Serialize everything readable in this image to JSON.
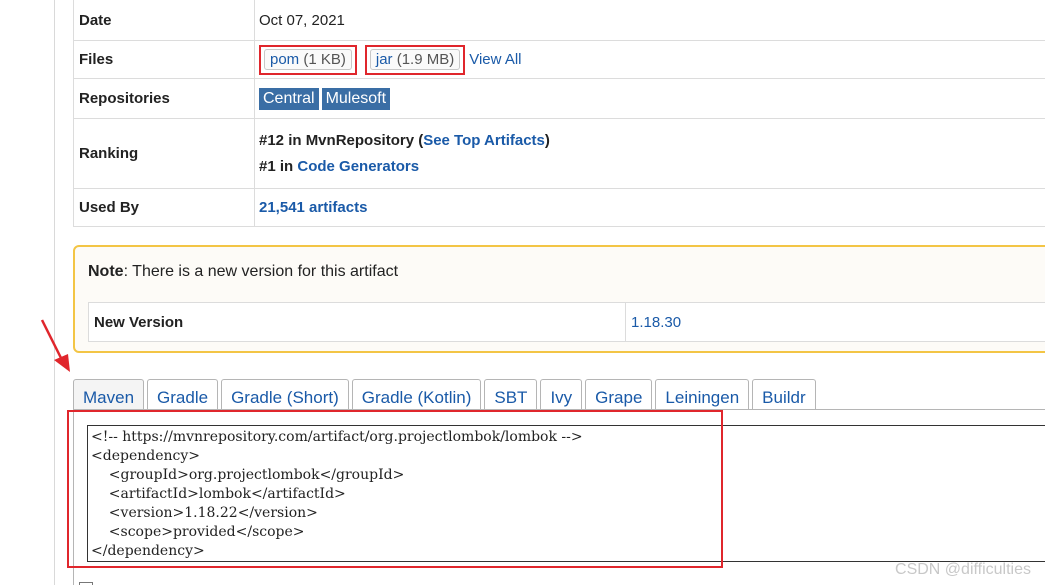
{
  "details": {
    "date": {
      "label": "Date",
      "value": "Oct 07, 2021"
    },
    "files": {
      "label": "Files",
      "pom": {
        "name": "pom",
        "size": "(1 KB)"
      },
      "jar": {
        "name": "jar",
        "size": "(1.9 MB)"
      },
      "view_all": "View All"
    },
    "repositories": {
      "label": "Repositories",
      "items": [
        "Central",
        "Mulesoft"
      ]
    },
    "ranking": {
      "label": "Ranking",
      "line1": {
        "prefix": "#12 in MvnRepository (",
        "link": "See Top Artifacts",
        "suffix": ")"
      },
      "line2": {
        "prefix": "#1 in ",
        "link": "Code Generators"
      }
    },
    "used_by": {
      "label": "Used By",
      "value": "21,541 artifacts"
    }
  },
  "note": {
    "bold": "Note",
    "text": ": There is a new version for this artifact",
    "new_version_label": "New Version",
    "new_version_value": "1.18.30"
  },
  "tabs": [
    "Maven",
    "Gradle",
    "Gradle (Short)",
    "Gradle (Kotlin)",
    "SBT",
    "Ivy",
    "Grape",
    "Leiningen",
    "Buildr"
  ],
  "active_tab": "Maven",
  "code": "<!-- https://mvnrepository.com/artifact/org.projectlombok/lombok -->\n<dependency>\n    <groupId>org.projectlombok</groupId>\n    <artifactId>lombok</artifactId>\n    <version>1.18.22</version>\n    <scope>provided</scope>\n</dependency>",
  "watermark": "CSDN @difficulties",
  "colors": {
    "link": "#1a5aa8",
    "highlight": "#e0262c",
    "note_border": "#f3c545",
    "tag_bg": "#3a6ea5"
  }
}
